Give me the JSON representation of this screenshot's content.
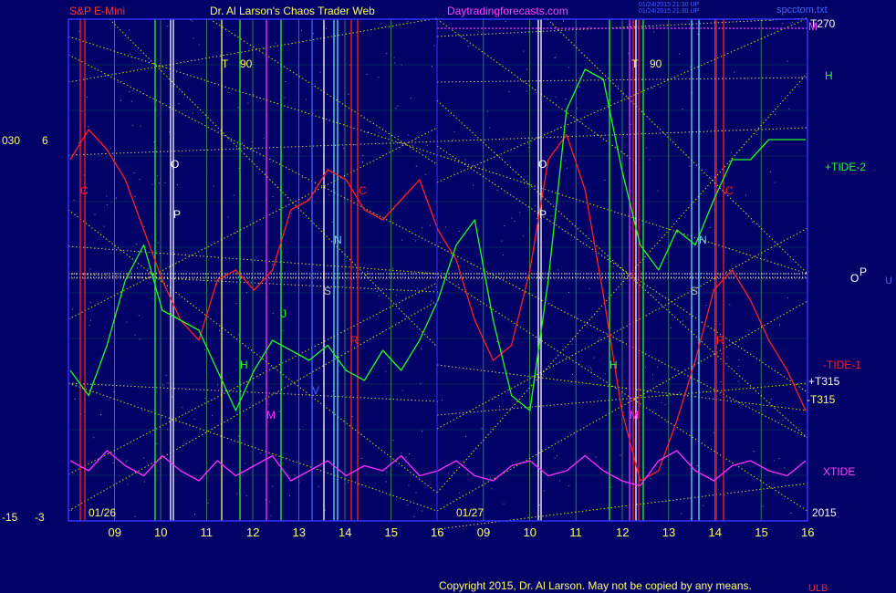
{
  "header": {
    "symbol": "S&P E-Mini",
    "author": "Dr. Al Larson's Chaos Trader Web",
    "site": "Daytradingforecasts.com",
    "file_label": "spcctom.txt",
    "timestamp_1": "01/24/2015 21:30 UP",
    "timestamp_2": "01/24/2015 21:30 UP"
  },
  "left_scale": {
    "top_a": "030",
    "top_b": "6",
    "bottom_a": "-15",
    "bottom_b": "-3"
  },
  "right_labels": {
    "t270": "T270",
    "m": "M",
    "h": "H",
    "tide2": "+TIDE-2",
    "o": "O",
    "p": "P",
    "u": "U",
    "tide1": "-TIDE-1",
    "t315a": "+T315",
    "t315b": "-T315",
    "xtide": "XTIDE",
    "year": "2015"
  },
  "footer": {
    "copyright": "Copyright 2015, Dr. Al Larson. May not be copied by any means.",
    "tag": "ULB"
  },
  "colors": {
    "background": "#000066",
    "border": "#3333ff",
    "grid": "#2e7d55",
    "red_line": "#ff2020",
    "green_line": "#20ff20",
    "magenta_line": "#ff30ff",
    "yellow_dotted": "#ffff00",
    "white_line": "#ffffff",
    "cyan_line": "#66ddff",
    "header_red": "#ff3333",
    "header_yellow": "#ffff66",
    "header_magenta": "#ff44ff"
  },
  "chart_data": {
    "type": "line",
    "title": "S&P E-Mini",
    "days": [
      "01/26",
      "01/27"
    ],
    "x_ticks": [
      "09",
      "10",
      "11",
      "12",
      "13",
      "14",
      "15",
      "16",
      "09",
      "10",
      "11",
      "12",
      "13",
      "14",
      "15",
      "16"
    ],
    "series": [
      {
        "name": "-TIDE-1",
        "color": "#ff2020",
        "values": [
          0.72,
          0.78,
          0.74,
          0.68,
          0.58,
          0.48,
          0.4,
          0.36,
          0.48,
          0.5,
          0.46,
          0.5,
          0.62,
          0.64,
          0.7,
          0.68,
          0.62,
          0.6,
          0.64,
          0.68,
          0.58,
          0.52,
          0.4,
          0.32,
          0.35,
          0.5,
          0.72,
          0.77,
          0.66,
          0.45,
          0.22,
          0.08,
          0.1,
          0.2,
          0.32,
          0.46,
          0.5,
          0.44,
          0.36,
          0.3,
          0.22
        ]
      },
      {
        "name": "+TIDE-2",
        "color": "#20ff20",
        "values": [
          0.3,
          0.25,
          0.35,
          0.48,
          0.55,
          0.42,
          0.4,
          0.38,
          0.3,
          0.22,
          0.3,
          0.36,
          0.34,
          0.32,
          0.35,
          0.3,
          0.28,
          0.34,
          0.3,
          0.36,
          0.44,
          0.55,
          0.6,
          0.4,
          0.25,
          0.22,
          0.48,
          0.82,
          0.9,
          0.88,
          0.7,
          0.55,
          0.5,
          0.58,
          0.55,
          0.64,
          0.72,
          0.72,
          0.76,
          0.76,
          0.76
        ]
      },
      {
        "name": "XTIDE",
        "color": "#ff30ff",
        "values": [
          0.12,
          0.1,
          0.14,
          0.11,
          0.09,
          0.13,
          0.1,
          0.08,
          0.12,
          0.09,
          0.11,
          0.13,
          0.08,
          0.1,
          0.12,
          0.09,
          0.11,
          0.1,
          0.13,
          0.09,
          0.1,
          0.12,
          0.09,
          0.08,
          0.11,
          0.12,
          0.09,
          0.1,
          0.13,
          0.1,
          0.08,
          0.07,
          0.12,
          0.14,
          0.1,
          0.08,
          0.11,
          0.12,
          0.1,
          0.09,
          0.12
        ]
      }
    ],
    "vertical_line_labels": [
      "C",
      "O",
      "P",
      "T",
      "90",
      "H",
      "M",
      "J",
      "N",
      "S",
      "V",
      "R"
    ]
  }
}
